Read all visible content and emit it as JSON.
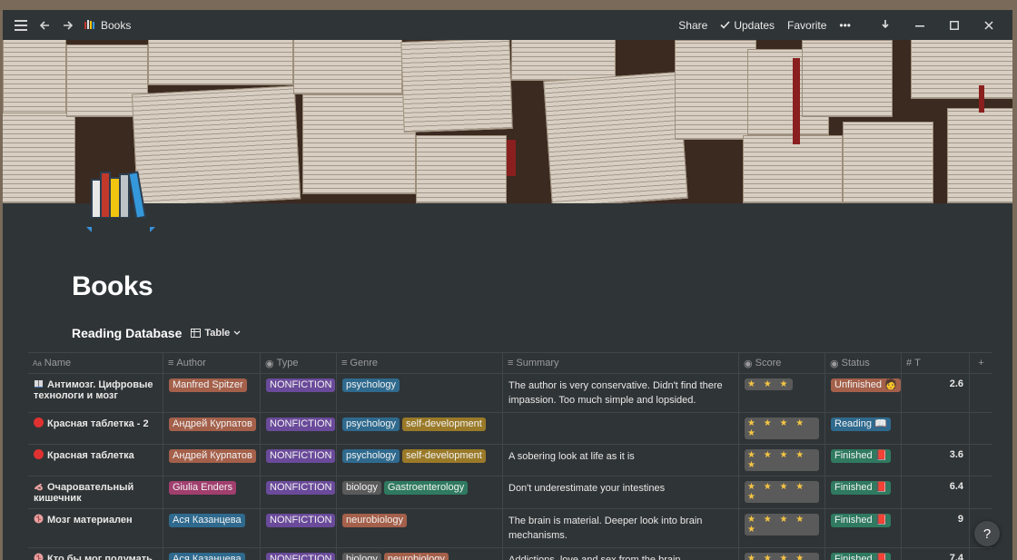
{
  "window": {
    "title": "Books",
    "actions": {
      "share": "Share",
      "updates": "Updates",
      "favorite": "Favorite",
      "more": "•••"
    }
  },
  "page": {
    "title": "Books"
  },
  "database": {
    "title": "Reading Database",
    "view": "Table"
  },
  "table": {
    "columns": {
      "name": "Name",
      "author": "Author",
      "type": "Type",
      "genre": "Genre",
      "summary": "Summary",
      "score": "Score",
      "status": "Status",
      "t": "T",
      "add": "+"
    },
    "rows": [
      {
        "icon": "book-icon",
        "name": "Антимозг. Цифровые технологи и мозг",
        "author": "Manfred Spitzer",
        "author_color": "#a4604a",
        "type": "NONFICTION",
        "genres": [
          {
            "label": "psychology",
            "color": "#2f6a8e"
          }
        ],
        "summary": "The author is very conservative. Didn't find there impassion. Too much simple and lopsided.",
        "score": "★ ★ ★",
        "status": "Unfinished 🧑",
        "status_color": "#a4604a",
        "t": "2.6"
      },
      {
        "icon": "red-circle-icon",
        "name": "Красная таблетка - 2",
        "author": "Андрей Курпатов",
        "author_color": "#a4604a",
        "type": "NONFICTION",
        "genres": [
          {
            "label": "psychology",
            "color": "#2f6a8e"
          },
          {
            "label": "self-development",
            "color": "#9a7a28"
          }
        ],
        "summary": "",
        "score": "★ ★ ★ ★ ★",
        "status": "Reading 📖",
        "status_color": "#2f6a8e",
        "t": ""
      },
      {
        "icon": "red-circle-icon",
        "name": "Красная таблетка",
        "author": "Андрей Курпатов",
        "author_color": "#a4604a",
        "type": "NONFICTION",
        "genres": [
          {
            "label": "psychology",
            "color": "#2f6a8e"
          },
          {
            "label": "self-development",
            "color": "#9a7a28"
          }
        ],
        "summary": "A sobering look at life as it is",
        "score": "★ ★ ★ ★ ★",
        "status": "Finished 📕",
        "status_color": "#2f7a60",
        "t": "3.6"
      },
      {
        "icon": "intestine-icon",
        "name": "Очаровательный кишечник",
        "author": "Giulia Enders",
        "author_color": "#a13f6e",
        "type": "NONFICTION",
        "genres": [
          {
            "label": "biology",
            "color": "#5a5a5a"
          },
          {
            "label": "Gastroenterology",
            "color": "#2f7a60"
          }
        ],
        "summary": "Don't underestimate your intestines",
        "score": "★ ★ ★ ★ ★",
        "status": "Finished 📕",
        "status_color": "#2f7a60",
        "t": "6.4"
      },
      {
        "icon": "brain-icon",
        "name": "Мозг материален",
        "author": "Ася Казанцева",
        "author_color": "#2f6a8e",
        "type": "NONFICTION",
        "genres": [
          {
            "label": "neurobiology",
            "color": "#a4604a"
          }
        ],
        "summary": "The brain is material. Deeper look into brain mechanisms.",
        "score": "★ ★ ★ ★ ★",
        "status": "Finished 📕",
        "status_color": "#2f7a60",
        "t": "9"
      },
      {
        "icon": "brain-icon",
        "name": "Кто бы мог подумать",
        "author": "Ася Казанцева",
        "author_color": "#2f6a8e",
        "type": "NONFICTION",
        "genres": [
          {
            "label": "biology",
            "color": "#5a5a5a"
          },
          {
            "label": "neurobiology",
            "color": "#a4604a"
          }
        ],
        "summary": "Addictions, love and sex from the brain perspective",
        "score": "★ ★ ★ ★ ★",
        "status": "Finished 📕",
        "status_color": "#2f7a60",
        "t": "7.4"
      }
    ]
  },
  "colors": {
    "type_tag": "#6a4a9a",
    "background": "#2f3437"
  },
  "help": "?"
}
